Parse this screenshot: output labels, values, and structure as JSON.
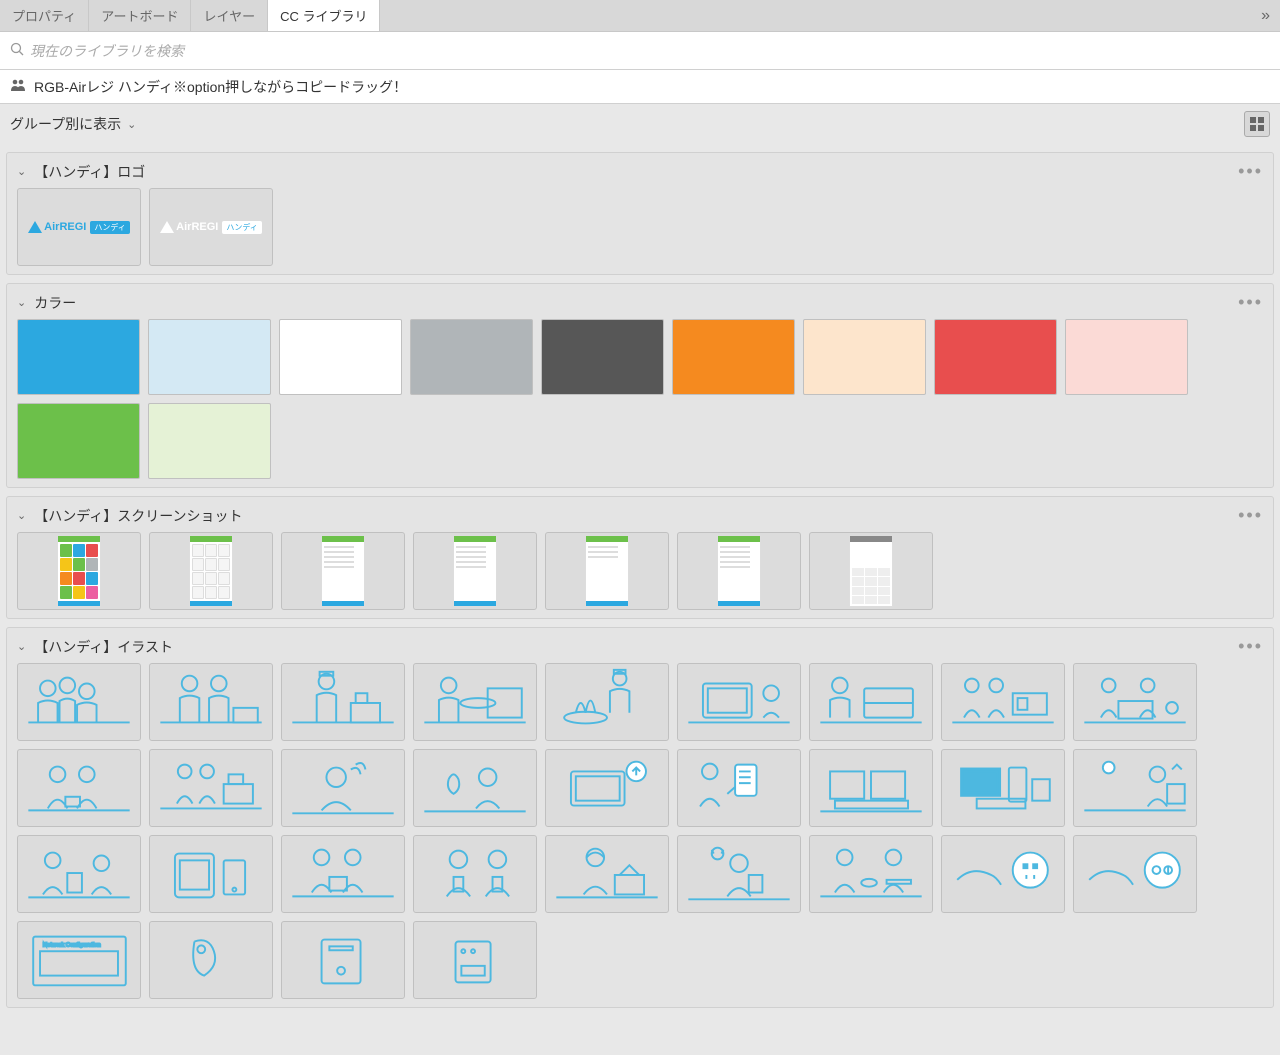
{
  "tabs": {
    "properties": "プロパティ",
    "artboard": "アートボード",
    "layer": "レイヤー",
    "cc_library": "CC ライブラリ"
  },
  "search": {
    "placeholder": "現在のライブラリを検索"
  },
  "library": {
    "name": "RGB-Airレジ ハンディ※option押しながらコピードラッグ！"
  },
  "view": {
    "group_by": "グループ別に表示"
  },
  "sections": {
    "logo": {
      "title": "【ハンディ】ロゴ",
      "items": [
        {
          "brand": "AirREGI",
          "badge": "ハンディ",
          "variant": "blue"
        },
        {
          "brand": "AirREGI",
          "badge": "ハンディ",
          "variant": "white"
        }
      ]
    },
    "color": {
      "title": "カラー",
      "swatches": [
        "#2ca8e0",
        "#d4e9f4",
        "#ffffff",
        "#b0b5b8",
        "#575757",
        "#f58a1f",
        "#fde5cc",
        "#e84e4e",
        "#fbdad6",
        "#6cc04a",
        "#e5f2d6"
      ]
    },
    "screenshots": {
      "title": "【ハンディ】スクリーンショット",
      "items": [
        {
          "type": "color-grid"
        },
        {
          "type": "white-grid"
        },
        {
          "type": "list"
        },
        {
          "type": "list"
        },
        {
          "type": "list-short"
        },
        {
          "type": "list"
        },
        {
          "type": "keypad"
        }
      ]
    },
    "illustrations": {
      "title": "【ハンディ】イラスト",
      "count": 31
    }
  }
}
